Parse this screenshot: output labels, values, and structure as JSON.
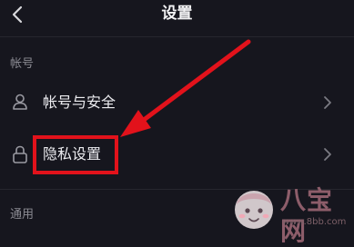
{
  "header": {
    "title": "设置"
  },
  "sections": [
    {
      "title": "帐号"
    },
    {
      "title": "通用"
    }
  ],
  "rows": [
    {
      "label": "帐号与安全",
      "icon": "user-icon"
    },
    {
      "label": "隐私设置",
      "icon": "lock-icon"
    }
  ],
  "annotation": {
    "highlight_color": "#e2121b",
    "arrow_color": "#e2121b"
  },
  "watermark": {
    "text": "八宝网",
    "url": "www.8bb.com"
  }
}
